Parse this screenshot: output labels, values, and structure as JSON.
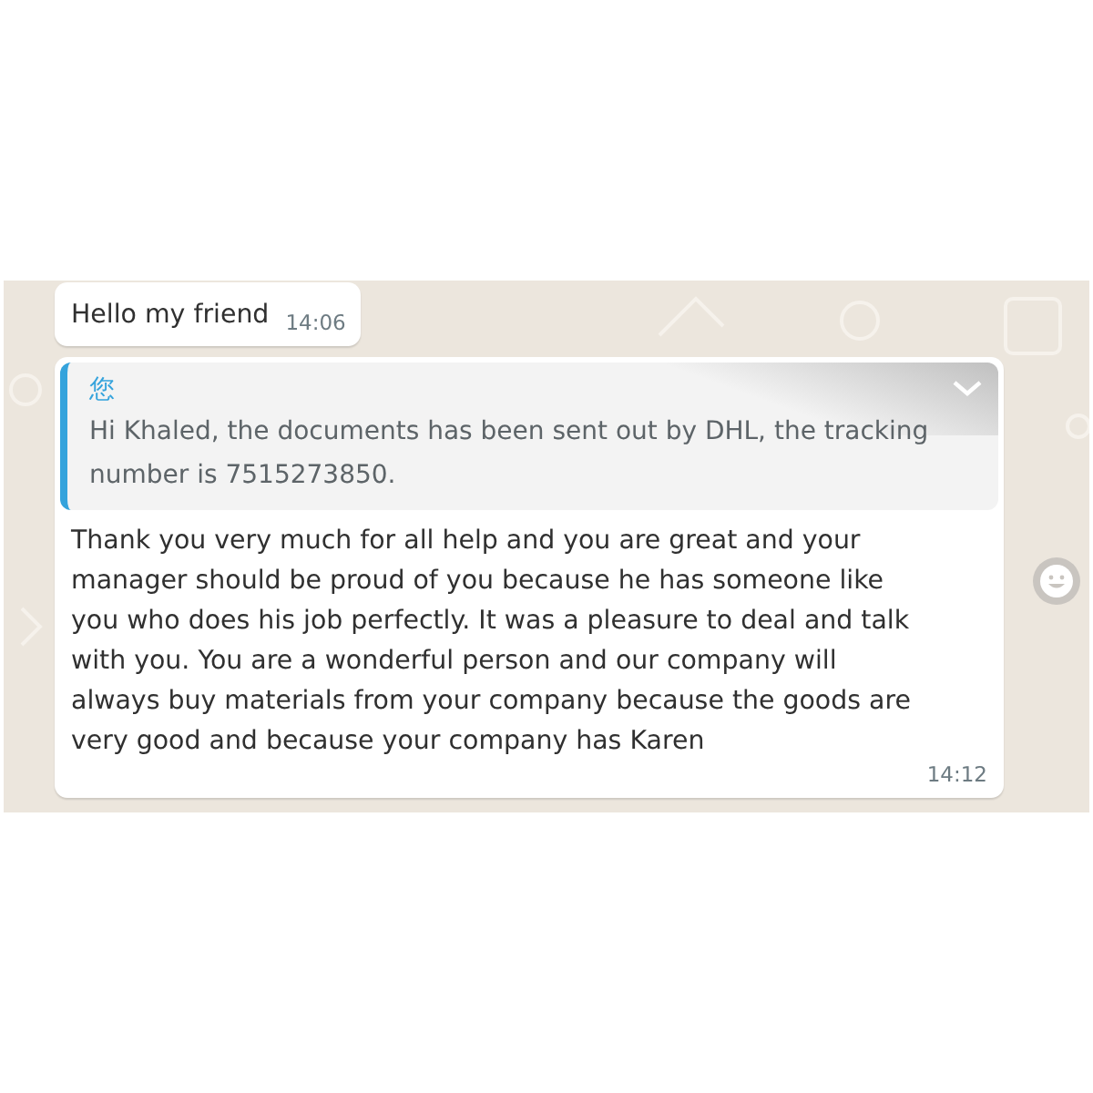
{
  "messages": [
    {
      "kind": "text",
      "text": "Hello my friend",
      "time": "14:06"
    },
    {
      "kind": "reply",
      "quote": {
        "sender": "您",
        "text": "Hi Khaled, the documents has been sent out by DHL, the tracking number is 7515273850."
      },
      "text": "Thank you very much for all help and you are great and your manager should be proud of you because he has someone like you who does his job perfectly. It was a pleasure to deal and talk with you. You are a wonderful person and our company will always buy materials from your company because the goods are very good and because your company has Karen",
      "time": "14:12"
    }
  ]
}
